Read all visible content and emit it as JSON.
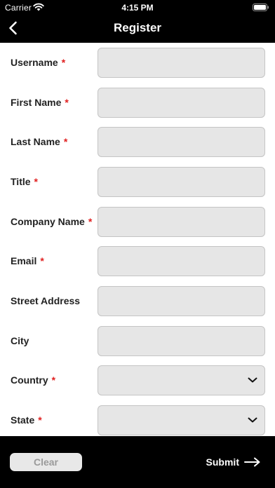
{
  "status_bar": {
    "carrier": "Carrier",
    "time": "4:15 PM"
  },
  "nav": {
    "title": "Register",
    "back_icon": "chevron-left-icon"
  },
  "form": {
    "required_marker": "*",
    "fields": [
      {
        "label": "Username",
        "required": true,
        "type": "text",
        "value": ""
      },
      {
        "label": "First Name",
        "required": true,
        "type": "text",
        "value": ""
      },
      {
        "label": "Last Name",
        "required": true,
        "type": "text",
        "value": ""
      },
      {
        "label": "Title",
        "required": true,
        "type": "text",
        "value": ""
      },
      {
        "label": "Company Name",
        "required": true,
        "type": "text",
        "value": ""
      },
      {
        "label": "Email",
        "required": true,
        "type": "text",
        "value": ""
      },
      {
        "label": "Street Address",
        "required": false,
        "type": "text",
        "value": ""
      },
      {
        "label": "City",
        "required": false,
        "type": "text",
        "value": ""
      },
      {
        "label": "Country",
        "required": true,
        "type": "select",
        "value": ""
      },
      {
        "label": "State",
        "required": true,
        "type": "select",
        "value": ""
      }
    ]
  },
  "bottom_bar": {
    "clear_label": "Clear",
    "submit_label": "Submit",
    "submit_icon": "arrow-right-icon"
  },
  "colors": {
    "bar_background": "#000000",
    "required_marker": "#e02020",
    "field_background": "#e6e6e6",
    "field_border": "#c4c4c4",
    "clear_button_background": "#e8e8e8",
    "clear_button_text": "#9a9a9a"
  }
}
